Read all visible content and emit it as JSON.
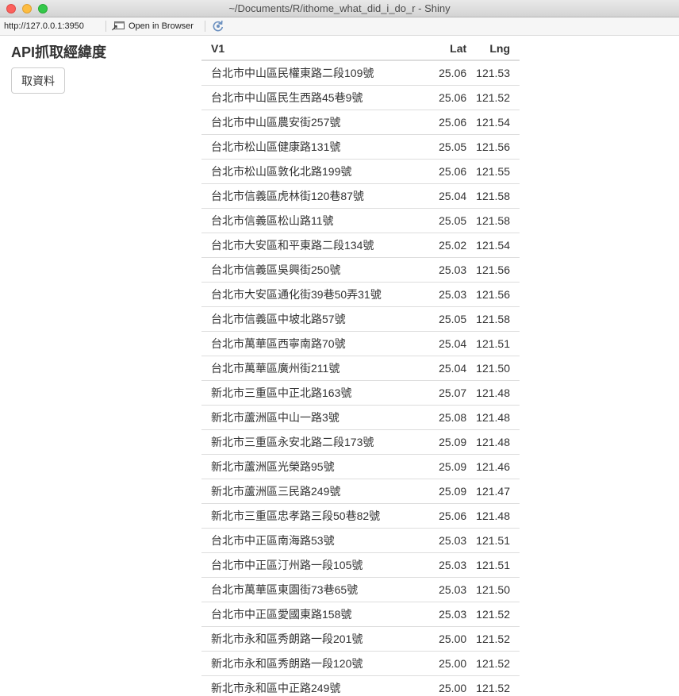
{
  "window": {
    "title": "~/Documents/R/ithome_what_did_i_do_r - Shiny"
  },
  "toolbar": {
    "url": "http://127.0.0.1:3950",
    "open_in_browser": "Open in Browser"
  },
  "app": {
    "title": "API抓取經緯度",
    "fetch_button": "取資料"
  },
  "table": {
    "headers": {
      "v1": "V1",
      "lat": "Lat",
      "lng": "Lng"
    },
    "rows": [
      {
        "v1": "台北市中山區民權東路二段109號",
        "lat": "25.06",
        "lng": "121.53"
      },
      {
        "v1": "台北市中山區民生西路45巷9號",
        "lat": "25.06",
        "lng": "121.52"
      },
      {
        "v1": "台北市中山區農安街257號",
        "lat": "25.06",
        "lng": "121.54"
      },
      {
        "v1": "台北市松山區健康路131號",
        "lat": "25.05",
        "lng": "121.56"
      },
      {
        "v1": "台北市松山區敦化北路199號",
        "lat": "25.06",
        "lng": "121.55"
      },
      {
        "v1": "台北市信義區虎林街120巷87號",
        "lat": "25.04",
        "lng": "121.58"
      },
      {
        "v1": "台北市信義區松山路11號",
        "lat": "25.05",
        "lng": "121.58"
      },
      {
        "v1": "台北市大安區和平東路二段134號",
        "lat": "25.02",
        "lng": "121.54"
      },
      {
        "v1": "台北市信義區吳興街250號",
        "lat": "25.03",
        "lng": "121.56"
      },
      {
        "v1": "台北市大安區通化街39巷50弄31號",
        "lat": "25.03",
        "lng": "121.56"
      },
      {
        "v1": "台北市信義區中坡北路57號",
        "lat": "25.05",
        "lng": "121.58"
      },
      {
        "v1": "台北市萬華區西寧南路70號",
        "lat": "25.04",
        "lng": "121.51"
      },
      {
        "v1": "台北市萬華區廣州街211號",
        "lat": "25.04",
        "lng": "121.50"
      },
      {
        "v1": "新北市三重區中正北路163號",
        "lat": "25.07",
        "lng": "121.48"
      },
      {
        "v1": "新北市蘆洲區中山一路3號",
        "lat": "25.08",
        "lng": "121.48"
      },
      {
        "v1": "新北市三重區永安北路二段173號",
        "lat": "25.09",
        "lng": "121.48"
      },
      {
        "v1": "新北市蘆洲區光榮路95號",
        "lat": "25.09",
        "lng": "121.46"
      },
      {
        "v1": "新北市蘆洲區三民路249號",
        "lat": "25.09",
        "lng": "121.47"
      },
      {
        "v1": "新北市三重區忠孝路三段50巷82號",
        "lat": "25.06",
        "lng": "121.48"
      },
      {
        "v1": "台北市中正區南海路53號",
        "lat": "25.03",
        "lng": "121.51"
      },
      {
        "v1": "台北市中正區汀州路一段105號",
        "lat": "25.03",
        "lng": "121.51"
      },
      {
        "v1": "台北市萬華區東園街73巷65號",
        "lat": "25.03",
        "lng": "121.50"
      },
      {
        "v1": "台北市中正區愛國東路158號",
        "lat": "25.03",
        "lng": "121.52"
      },
      {
        "v1": "新北市永和區秀朗路一段201號",
        "lat": "25.00",
        "lng": "121.52"
      },
      {
        "v1": "新北市永和區秀朗路一段120號",
        "lat": "25.00",
        "lng": "121.52"
      },
      {
        "v1": "新北市永和區中正路249號",
        "lat": "25.00",
        "lng": "121.52"
      }
    ]
  }
}
